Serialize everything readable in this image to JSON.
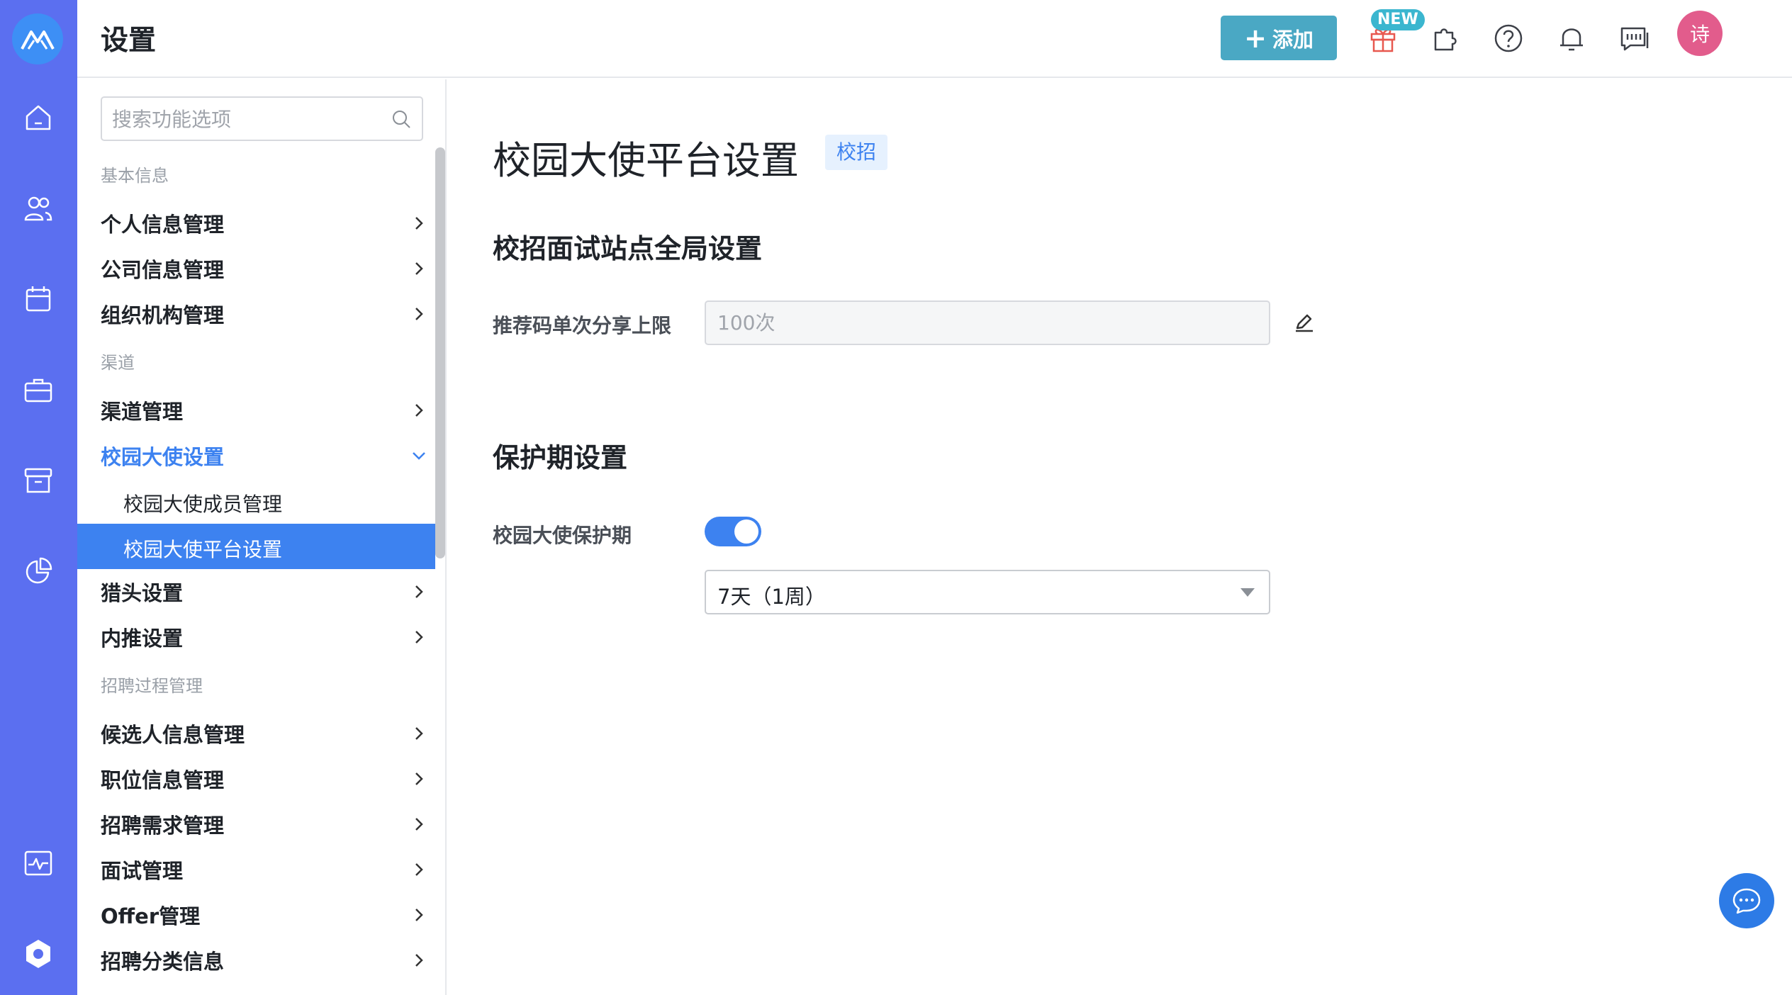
{
  "header": {
    "title": "设置",
    "add_label": "添加",
    "new_badge": "NEW",
    "avatar_text": "诗"
  },
  "colors": {
    "rail": "#5b6ff0",
    "accent": "#3d82f0",
    "add_button": "#4aa8c4",
    "avatar": "#e25c8c"
  },
  "rail": {
    "icons": [
      "logo-icon",
      "home-icon",
      "people-icon",
      "calendar-icon",
      "briefcase-icon",
      "archive-icon",
      "pie-chart-icon",
      "activity-icon",
      "settings-icon"
    ]
  },
  "sidebar": {
    "search_placeholder": "搜索功能选项",
    "groups": {
      "basic": "基本信息",
      "channel": "渠道",
      "process": "招聘过程管理"
    },
    "items": {
      "personal": "个人信息管理",
      "company": "公司信息管理",
      "org": "组织机构管理",
      "channel_mgmt": "渠道管理",
      "campus": "校园大使设置",
      "campus_members": "校园大使成员管理",
      "campus_platform": "校园大使平台设置",
      "headhunter": "猎头设置",
      "referral": "内推设置",
      "candidate": "候选人信息管理",
      "position": "职位信息管理",
      "demand": "招聘需求管理",
      "interview": "面试管理",
      "offer": "Offer管理",
      "category": "招聘分类信息"
    }
  },
  "main": {
    "page_title": "校园大使平台设置",
    "tag": "校招",
    "section1_title": "校招面试站点全局设置",
    "share_limit_label": "推荐码单次分享上限",
    "share_limit_value": "100次",
    "section2_title": "保护期设置",
    "protection_label": "校园大使保护期",
    "protection_enabled": true,
    "protection_period": "7天（1周）"
  }
}
